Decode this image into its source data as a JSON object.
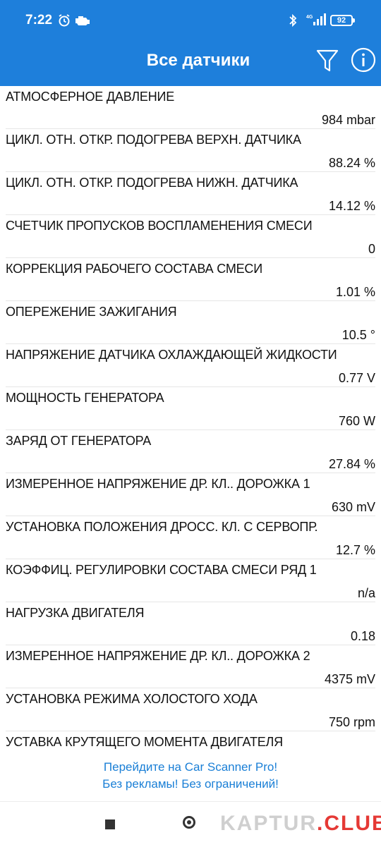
{
  "status_bar": {
    "time": "7:22",
    "battery": "92",
    "icons": [
      "alarm-icon",
      "engine-check-icon",
      "bluetooth-icon",
      "signal-4g-icon",
      "battery-icon"
    ]
  },
  "app_bar": {
    "title": "Все датчики",
    "actions": [
      "filter-icon",
      "info-icon"
    ],
    "color": "#1e7fdb"
  },
  "sensors": [
    {
      "name": "АТМОСФЕРНОЕ ДАВЛЕНИЕ",
      "value": "984 mbar"
    },
    {
      "name": "ЦИКЛ. ОТН. ОТКР. ПОДОГРЕВА ВЕРХН. ДАТЧИКА",
      "value": "88.24 %"
    },
    {
      "name": "ЦИКЛ. ОТН. ОТКР. ПОДОГРЕВА НИЖН. ДАТЧИКА",
      "value": "14.12 %"
    },
    {
      "name": "СЧЕТЧИК ПРОПУСКОВ ВОСПЛАМЕНЕНИЯ СМЕСИ",
      "value": "0"
    },
    {
      "name": "КОРРЕКЦИЯ РАБОЧЕГО СОСТАВА СМЕСИ",
      "value": "1.01 %"
    },
    {
      "name": "ОПЕРЕЖЕНИЕ ЗАЖИГАНИЯ",
      "value": "10.5 °"
    },
    {
      "name": "НАПРЯЖЕНИЕ ДАТЧИКА ОХЛАЖДАЮЩЕЙ ЖИДКОСТИ",
      "value": "0.77 V"
    },
    {
      "name": "МОЩНОСТЬ ГЕНЕРАТОРА",
      "value": "760 W"
    },
    {
      "name": "ЗАРЯД ОТ ГЕНЕРАТОРА",
      "value": "27.84 %"
    },
    {
      "name": "ИЗМЕРЕННОЕ НАПРЯЖЕНИЕ ДР. КЛ.. ДОРОЖКА 1",
      "value": "630 mV"
    },
    {
      "name": "УСТАНОВКА ПОЛОЖЕНИЯ ДРОСС. КЛ. С СЕРВОПР.",
      "value": "12.7 %"
    },
    {
      "name": "КОЭФФИЦ. РЕГУЛИРОВКИ СОСТАВА СМЕСИ  РЯД 1",
      "value": "n/a"
    },
    {
      "name": "НАГРУЗКА ДВИГАТЕЛЯ",
      "value": "0.18"
    },
    {
      "name": "ИЗМЕРЕННОЕ НАПРЯЖЕНИЕ ДР. КЛ.. ДОРОЖКА 2",
      "value": "4375 mV"
    },
    {
      "name": "УСТАНОВКА РЕЖИМА ХОЛОСТОГО ХОДА",
      "value": "750 rpm"
    },
    {
      "name": "УСТАВКА КРУТЯЩЕГО МОМЕНТА ДВИГАТЕЛЯ",
      "value": ""
    }
  ],
  "promo": {
    "line1": "Перейдите на Car Scanner Pro!",
    "line2": "Без рекламы! Без ограничений!",
    "color": "#1a7fd6"
  },
  "nav_bar": {
    "buttons": [
      "recents-square-icon",
      "home-circle-icon"
    ]
  },
  "watermark": {
    "part1": "KAPTUR",
    "dot": ".",
    "part2": "CLUB"
  }
}
